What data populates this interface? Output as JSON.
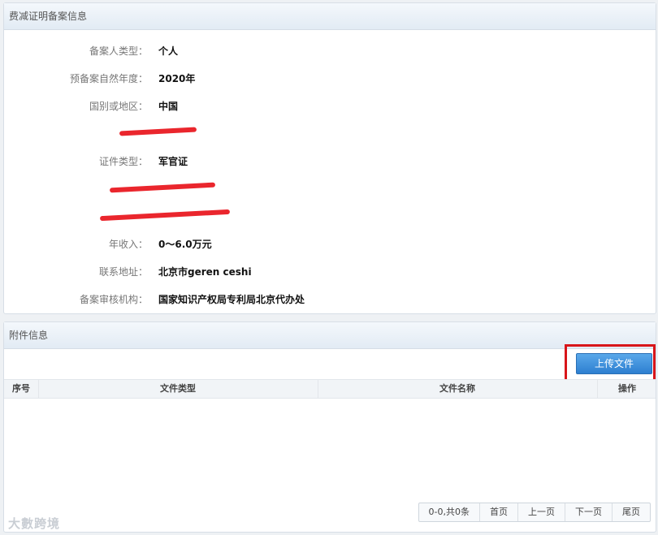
{
  "filing_panel": {
    "title": "费减证明备案信息",
    "rows": [
      {
        "label": "备案人类型：",
        "value": "个人"
      },
      {
        "label": "预备案自然年度：",
        "value": "2020年"
      },
      {
        "label": "国别或地区：",
        "value": "中国"
      },
      {
        "label": "",
        "value": ""
      },
      {
        "label": "证件类型：",
        "value": "军官证"
      },
      {
        "label": "",
        "value": ""
      },
      {
        "label": "",
        "value": ""
      },
      {
        "label": "年收入：",
        "value": "0～6.0万元"
      },
      {
        "label": "联系地址：",
        "value": "北京市geren ceshi"
      },
      {
        "label": "备案审核机构：",
        "value": "国家知识产权局专利局北京代办处"
      }
    ]
  },
  "attachment_panel": {
    "title": "附件信息",
    "upload_button": "上传文件",
    "columns": [
      "序号",
      "文件类型",
      "文件名称",
      "操作"
    ],
    "pager": {
      "summary": "0-0,共0条",
      "first": "首页",
      "prev": "上一页",
      "next": "下一页",
      "last": "尾页"
    }
  },
  "watermark": "大數跨境",
  "colors": {
    "accent_blue": "#2d7fd0",
    "annotation_red": "#d8151a"
  }
}
